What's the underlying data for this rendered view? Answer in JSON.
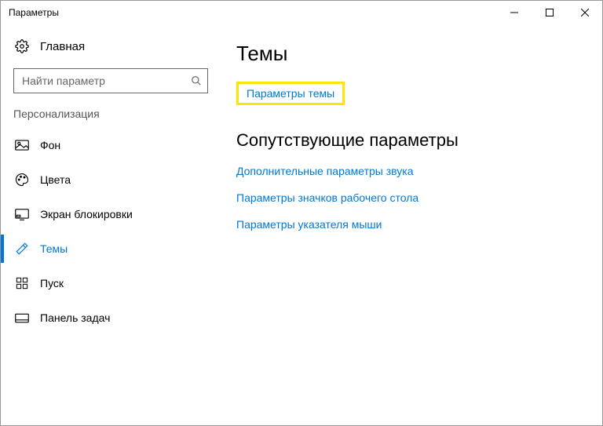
{
  "window": {
    "title": "Параметры"
  },
  "sidebar": {
    "home": "Главная",
    "search_placeholder": "Найти параметр",
    "section": "Персонализация",
    "items": [
      {
        "label": "Фон"
      },
      {
        "label": "Цвета"
      },
      {
        "label": "Экран блокировки"
      },
      {
        "label": "Темы"
      },
      {
        "label": "Пуск"
      },
      {
        "label": "Панель задач"
      }
    ]
  },
  "content": {
    "title": "Темы",
    "link_theme_settings": "Параметры темы",
    "related_heading": "Сопутствующие параметры",
    "related_links": [
      "Дополнительные параметры звука",
      "Параметры значков рабочего стола",
      "Параметры указателя мыши"
    ]
  }
}
